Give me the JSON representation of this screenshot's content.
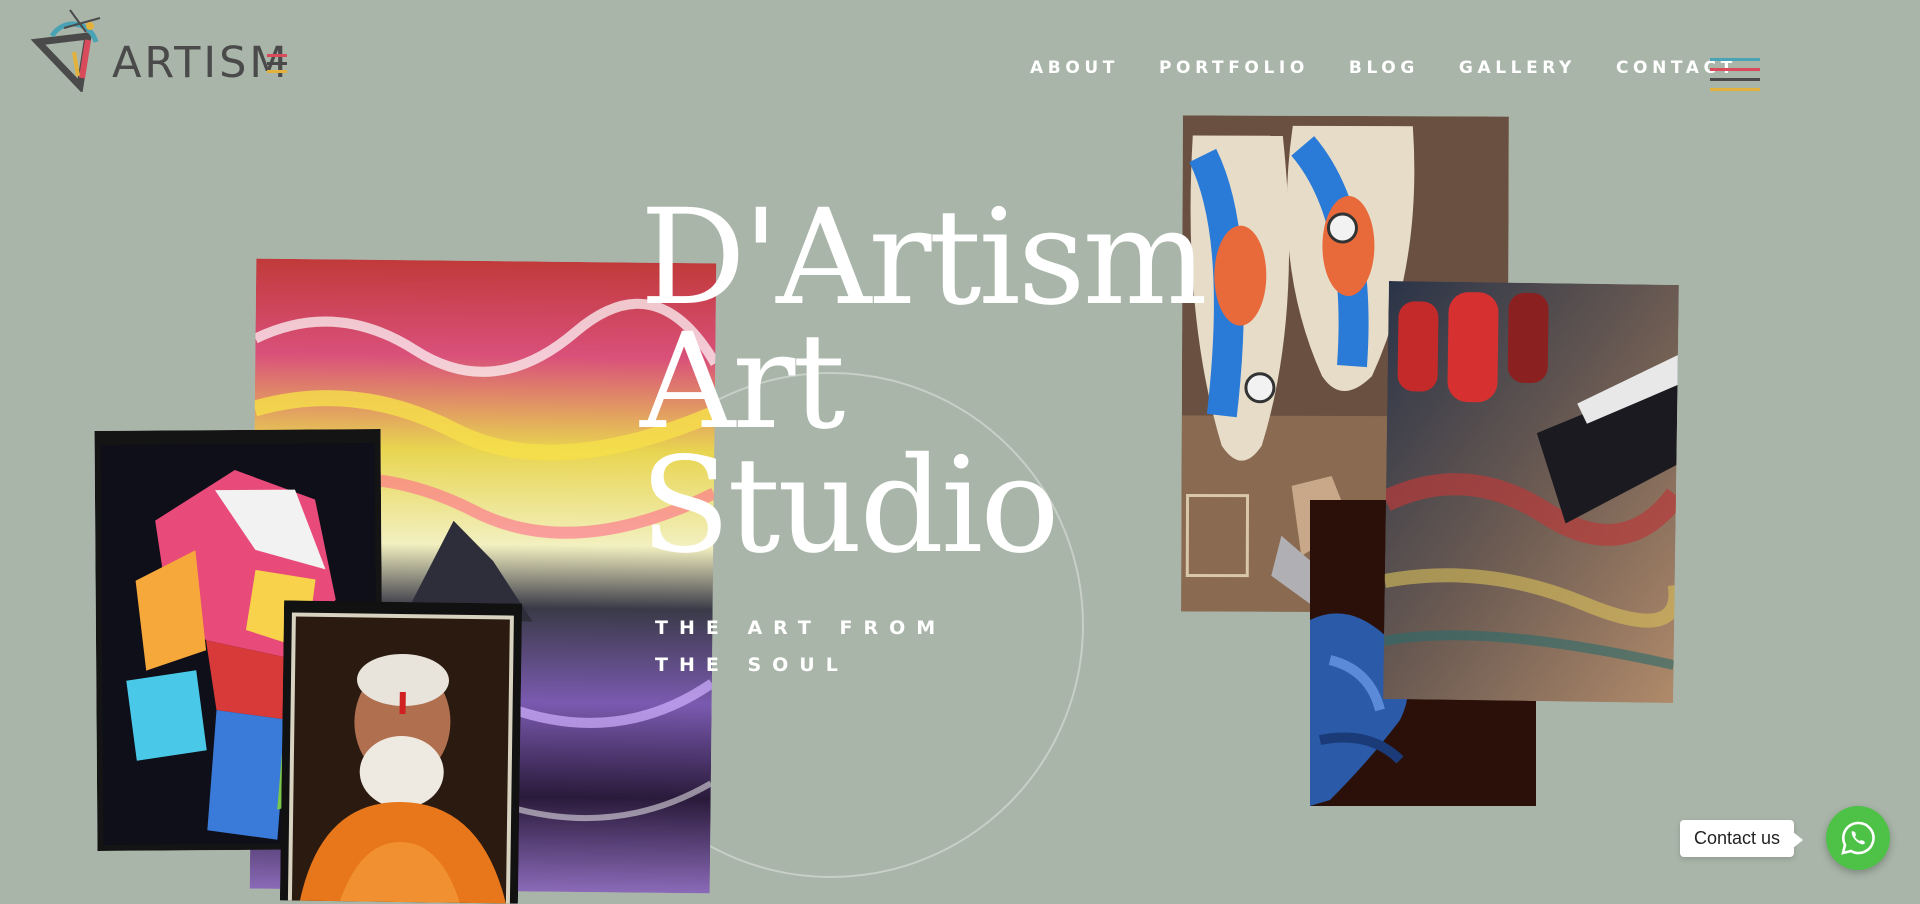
{
  "brand": {
    "logo_text": "ARTISM",
    "logo_colors": [
      "#d94a5a",
      "#4aa3b5",
      "#e3b23c",
      "#4a4a4a"
    ]
  },
  "nav": {
    "items": [
      "ABOUT",
      "PORTFOLIO",
      "BLOG",
      "GALLERY",
      "CONTACT"
    ]
  },
  "menu_icon": {
    "name": "hamburger-icon",
    "colors": [
      "#4aa3b5",
      "#d94a5a",
      "#4a4a4a",
      "#e3b23c"
    ]
  },
  "hero": {
    "title_lines": [
      "D'Artism",
      "Art",
      "Studio"
    ],
    "subtitle": "THE ART FROM THE SOUL"
  },
  "images": [
    {
      "name": "abstract-painting-image",
      "subject": "colorful abstract impasto painting"
    },
    {
      "name": "pop-art-portrait-image",
      "subject": "pop art portrait of a woman"
    },
    {
      "name": "sadhu-portrait-image",
      "subject": "oil portrait of an old man in orange robe"
    },
    {
      "name": "painted-skateboards-image",
      "subject": "koi fish painted on skateboards"
    },
    {
      "name": "paint-tubes-image",
      "subject": "red paint tubes and brush strokes"
    },
    {
      "name": "blue-hands-image",
      "subject": "hands covered in blue paint"
    }
  ],
  "contact": {
    "bubble_text": "Contact us",
    "icon": "whatsapp-icon",
    "color": "#4dc247"
  }
}
